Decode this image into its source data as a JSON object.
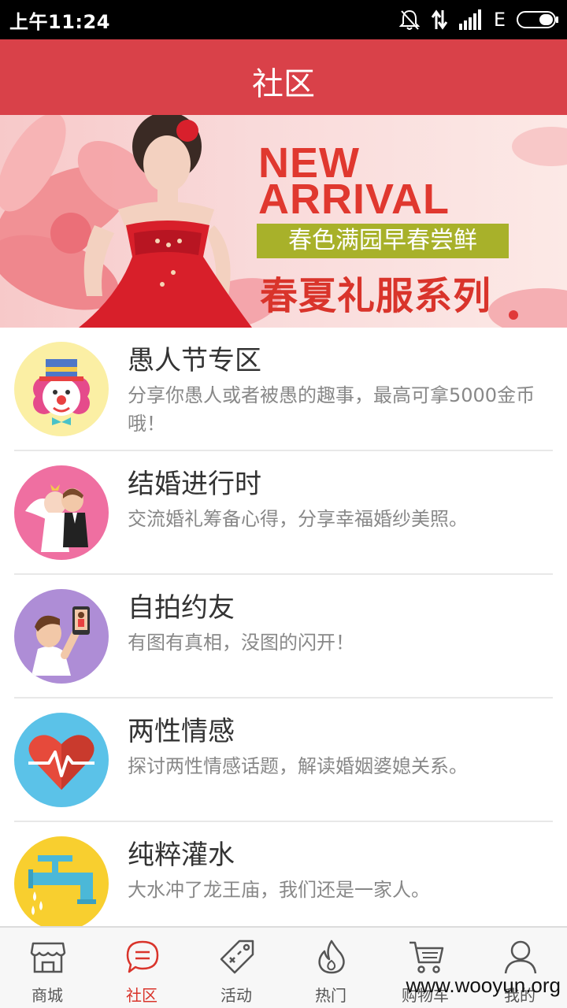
{
  "status_bar": {
    "time": "上午11:24",
    "network": "E",
    "icons": [
      "alarm-off-icon",
      "data-arrows-icon",
      "signal-icon",
      "battery-icon"
    ]
  },
  "header": {
    "title": "社区"
  },
  "banner": {
    "line1": "NEW",
    "line2": "ARRIVAL",
    "subtitle": "春色满园早春尝鲜",
    "title": "春夏礼服系列",
    "accent_color": "#e0382f"
  },
  "forums": [
    {
      "title": "愚人节专区",
      "desc": "分享你愚人或者被愚的趣事，最高可拿5000金币哦！",
      "icon": "clown-icon",
      "color": "#fbefa4"
    },
    {
      "title": "结婚进行时",
      "desc": "交流婚礼筹备心得，分享幸福婚纱美照。",
      "icon": "wedding-couple-icon",
      "color": "#ef6fa1"
    },
    {
      "title": "自拍约友",
      "desc": "有图有真相，没图的闪开！",
      "icon": "selfie-icon",
      "color": "#ae8dd6"
    },
    {
      "title": "两性情感",
      "desc": "探讨两性情感话题，解读婚姻婆媳关系。",
      "icon": "heart-pulse-icon",
      "color": "#5bc2e8"
    },
    {
      "title": "纯粹灌水",
      "desc": "大水冲了龙王庙，我们还是一家人。",
      "icon": "faucet-icon",
      "color": "#f8cf2f"
    }
  ],
  "nav": [
    {
      "label": "商城",
      "icon": "store-icon",
      "active": false
    },
    {
      "label": "社区",
      "icon": "chat-icon",
      "active": true
    },
    {
      "label": "活动",
      "icon": "tag-icon",
      "active": false
    },
    {
      "label": "热门",
      "icon": "flame-icon",
      "active": false
    },
    {
      "label": "购物车",
      "icon": "cart-icon",
      "active": false
    },
    {
      "label": "我的",
      "icon": "user-icon",
      "active": false
    }
  ],
  "watermark": "www.wooyun.org",
  "theme": {
    "primary": "#d94149",
    "text": "#333333",
    "muted": "#888888"
  }
}
